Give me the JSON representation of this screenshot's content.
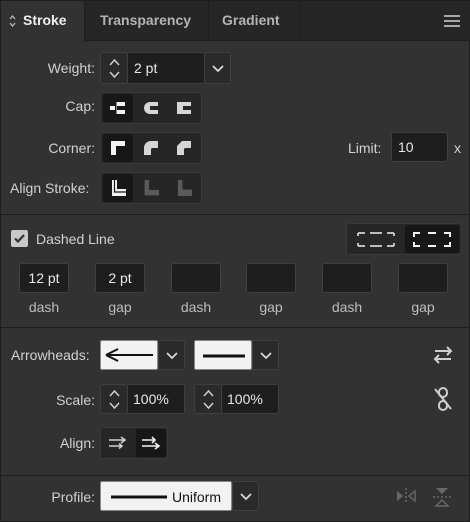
{
  "tabs": [
    {
      "label": "Stroke",
      "active": true
    },
    {
      "label": "Transparency",
      "active": false
    },
    {
      "label": "Gradient",
      "active": false
    }
  ],
  "weight": {
    "label": "Weight:",
    "value": "2 pt"
  },
  "cap": {
    "label": "Cap:",
    "options": [
      "butt-cap-icon",
      "round-cap-icon",
      "projecting-cap-icon"
    ],
    "selected_index": 0
  },
  "corner": {
    "label": "Corner:",
    "options": [
      "miter-join-icon",
      "round-join-icon",
      "bevel-join-icon"
    ],
    "selected_index": 0
  },
  "limit": {
    "label": "Limit:",
    "value": "10",
    "unit": "x"
  },
  "align_stroke": {
    "label": "Align Stroke:",
    "options": [
      "align-center-icon",
      "align-inside-icon",
      "align-outside-icon"
    ],
    "selected_index": 0
  },
  "dashed_line": {
    "label": "Dashed Line",
    "checked": true
  },
  "dashes": [
    {
      "value": "12 pt",
      "label": "dash"
    },
    {
      "value": "2 pt",
      "label": "gap"
    },
    {
      "value": "",
      "label": "dash"
    },
    {
      "value": "",
      "label": "gap"
    },
    {
      "value": "",
      "label": "dash"
    },
    {
      "value": "",
      "label": "gap"
    }
  ],
  "arrowheads": {
    "label": "Arrowheads:"
  },
  "scale": {
    "label": "Scale:",
    "start": "100%",
    "end": "100%"
  },
  "align": {
    "label": "Align:"
  },
  "profile": {
    "label": "Profile:",
    "value": "Uniform"
  },
  "colors": {
    "panel": "#323232",
    "tabbar": "#262626",
    "field": "#1e1e1e",
    "text": "#d6d6d6"
  }
}
